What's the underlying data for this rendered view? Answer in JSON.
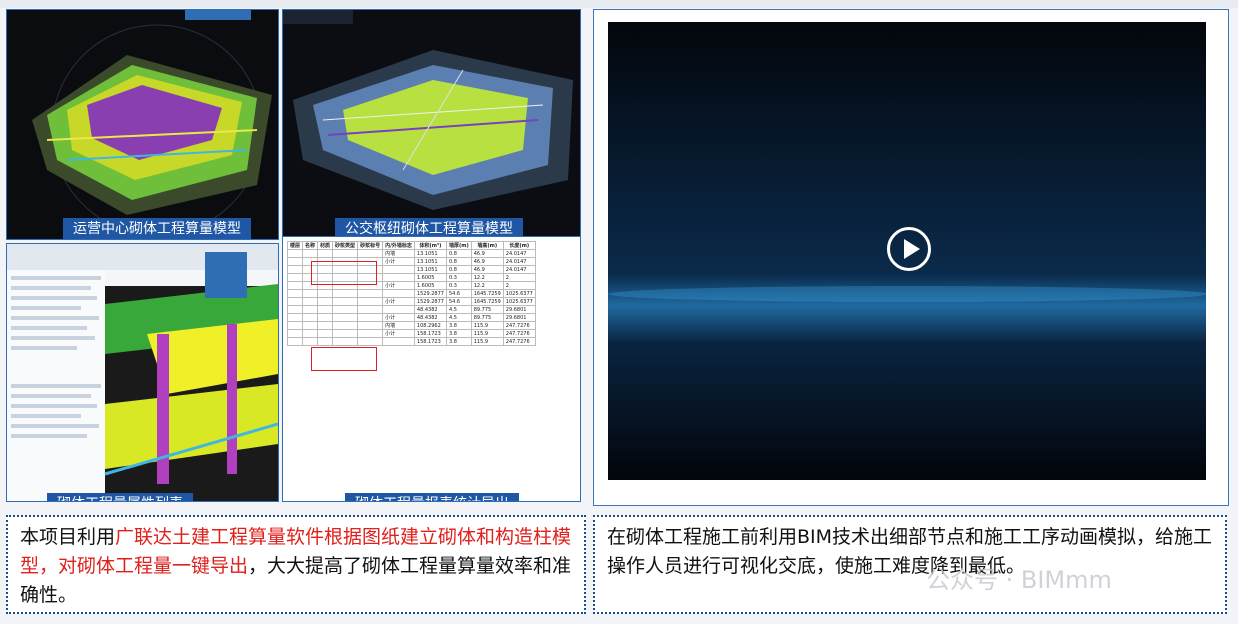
{
  "captions": {
    "model1": "运营中心砌体工程算量模型",
    "model2": "公交枢纽砌体工程算量模型",
    "attr": "砌体工程量属性列表",
    "report": "砌体工程量报表统计导出"
  },
  "left_text": {
    "part1": "本项目利用",
    "part2": "广联达土建工程算量软件根据图纸建立砌体和构造柱模型，对砌体工程量一键导出",
    "part3": "，大大提高了砌体工程量算量效率和准确性。"
  },
  "right_text": "在砌体工程施工前利用BIM技术出细部节点和施工工序动画模拟，给施工操作人员进行可视化交底，使施工难度降到最低。",
  "watermark": "公众号 · BIMmm",
  "report_table": {
    "headers": [
      "楼层",
      "名称",
      "材质",
      "砂浆类型",
      "砂浆标号",
      "内/外墙标志",
      "体积(m³)",
      "墙厚(m)",
      "墙高(m)",
      "长度(m)"
    ],
    "rows": [
      [
        "",
        "",
        "",
        "",
        "",
        "内墙",
        "13.1051",
        "0.8",
        "46.9",
        "24.0147"
      ],
      [
        "",
        "",
        "",
        "",
        "",
        "小计",
        "13.1051",
        "0.8",
        "46.9",
        "24.0147"
      ],
      [
        "",
        "",
        "",
        "",
        "",
        "",
        "13.1051",
        "0.8",
        "46.9",
        "24.0147"
      ],
      [
        "",
        "",
        "",
        "",
        "",
        "",
        "1.6005",
        "0.3",
        "12.2",
        "2"
      ],
      [
        "",
        "",
        "",
        "",
        "",
        "小计",
        "1.6005",
        "0.3",
        "12.2",
        "2"
      ],
      [
        "",
        "",
        "",
        "",
        "",
        "",
        "1529.2877",
        "54.6",
        "1645.7259",
        "1025.6377"
      ],
      [
        "",
        "",
        "",
        "",
        "",
        "小计",
        "1529.2877",
        "54.6",
        "1645.7259",
        "1025.6377"
      ],
      [
        "",
        "",
        "",
        "",
        "",
        "",
        "48.4382",
        "4.5",
        "89.775",
        "29.6801"
      ],
      [
        "",
        "",
        "",
        "",
        "",
        "小计",
        "48.4382",
        "4.5",
        "89.775",
        "29.6801"
      ],
      [
        "",
        "",
        "",
        "",
        "",
        "内墙",
        "108.2962",
        "3.8",
        "115.9",
        "247.7276"
      ],
      [
        "",
        "",
        "",
        "",
        "",
        "小计",
        "158.1723",
        "3.8",
        "115.9",
        "247.7276"
      ],
      [
        "",
        "",
        "",
        "",
        "",
        "",
        "158.1723",
        "3.8",
        "115.9",
        "247.7276"
      ]
    ]
  },
  "colors": {
    "accent": "#1f57a4",
    "highlight": "#e0201c"
  }
}
